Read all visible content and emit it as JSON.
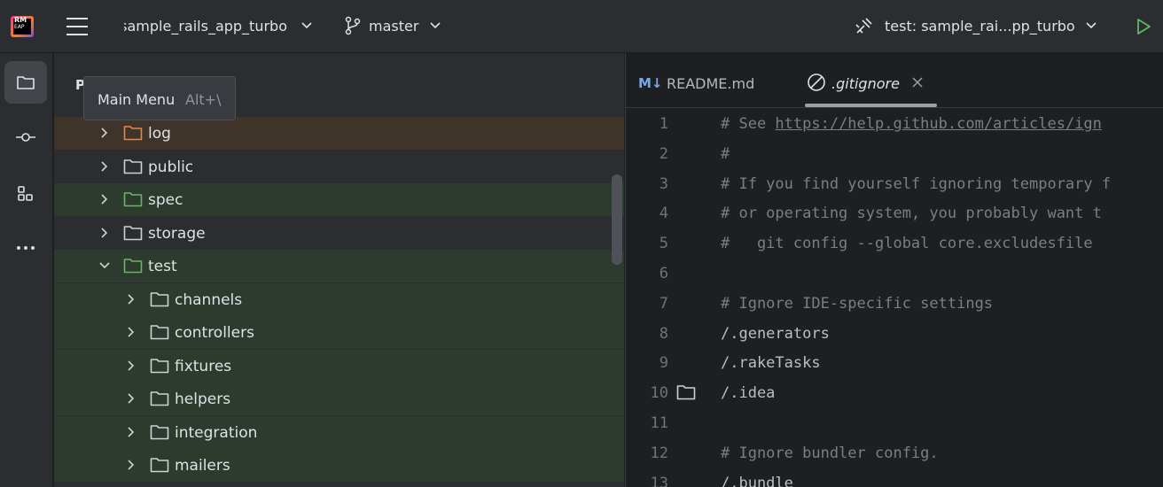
{
  "toolbar": {
    "logo_top": "RM",
    "logo_bottom": "EAP",
    "project_name": "sample_rails_app_turbo",
    "branch": "master",
    "run_config": "test: sample_rai...pp_turbo"
  },
  "tooltip": {
    "label": "Main Menu",
    "shortcut": "Alt+\\"
  },
  "project_panel": {
    "title": "P"
  },
  "tree": [
    {
      "label": "log",
      "expanded": false,
      "color": "#e08855"
    },
    {
      "label": "public",
      "expanded": false,
      "color": "#ced0d6"
    },
    {
      "label": "spec",
      "expanded": false,
      "color": "#6ab36b"
    },
    {
      "label": "storage",
      "expanded": false,
      "color": "#ced0d6"
    },
    {
      "label": "test",
      "expanded": true,
      "color": "#6ab36b"
    },
    {
      "label": "channels",
      "expanded": false,
      "color": "#ced0d6"
    },
    {
      "label": "controllers",
      "expanded": false,
      "color": "#ced0d6"
    },
    {
      "label": "fixtures",
      "expanded": false,
      "color": "#ced0d6"
    },
    {
      "label": "helpers",
      "expanded": false,
      "color": "#ced0d6"
    },
    {
      "label": "integration",
      "expanded": false,
      "color": "#ced0d6"
    },
    {
      "label": "mailers",
      "expanded": false,
      "color": "#ced0d6"
    }
  ],
  "editor": {
    "tabs": [
      {
        "icon_text": "M↓",
        "label": "README.md",
        "active": false
      },
      {
        "label": ".gitignore",
        "active": true
      }
    ],
    "lines": [
      {
        "num": "1",
        "pre": "# See ",
        "url": "https://help.github.com/articles/ign",
        "post": "",
        "comment": true
      },
      {
        "num": "2",
        "pre": "#",
        "comment": true
      },
      {
        "num": "3",
        "pre": "# If you find yourself ignoring temporary f",
        "comment": true
      },
      {
        "num": "4",
        "pre": "# or operating system, you probably want t",
        "comment": true
      },
      {
        "num": "5",
        "pre": "#   git config --global core.excludesfile",
        "comment": true
      },
      {
        "num": "6",
        "pre": "",
        "comment": false
      },
      {
        "num": "7",
        "pre": "# Ignore IDE-specific settings",
        "comment": true
      },
      {
        "num": "8",
        "pre": "/.generators",
        "comment": false
      },
      {
        "num": "9",
        "pre": "/.rakeTasks",
        "comment": false
      },
      {
        "num": "10",
        "pre": "/.idea",
        "comment": false
      },
      {
        "num": "11",
        "pre": "",
        "comment": false
      },
      {
        "num": "12",
        "pre": "# Ignore bundler config.",
        "comment": true
      },
      {
        "num": "13",
        "pre": "/.bundle",
        "comment": false
      }
    ]
  },
  "colors": {
    "accent_green": "#5fb865",
    "row_highlight_orange": "#3e3429",
    "row_highlight_green": "#2d3a2e"
  }
}
